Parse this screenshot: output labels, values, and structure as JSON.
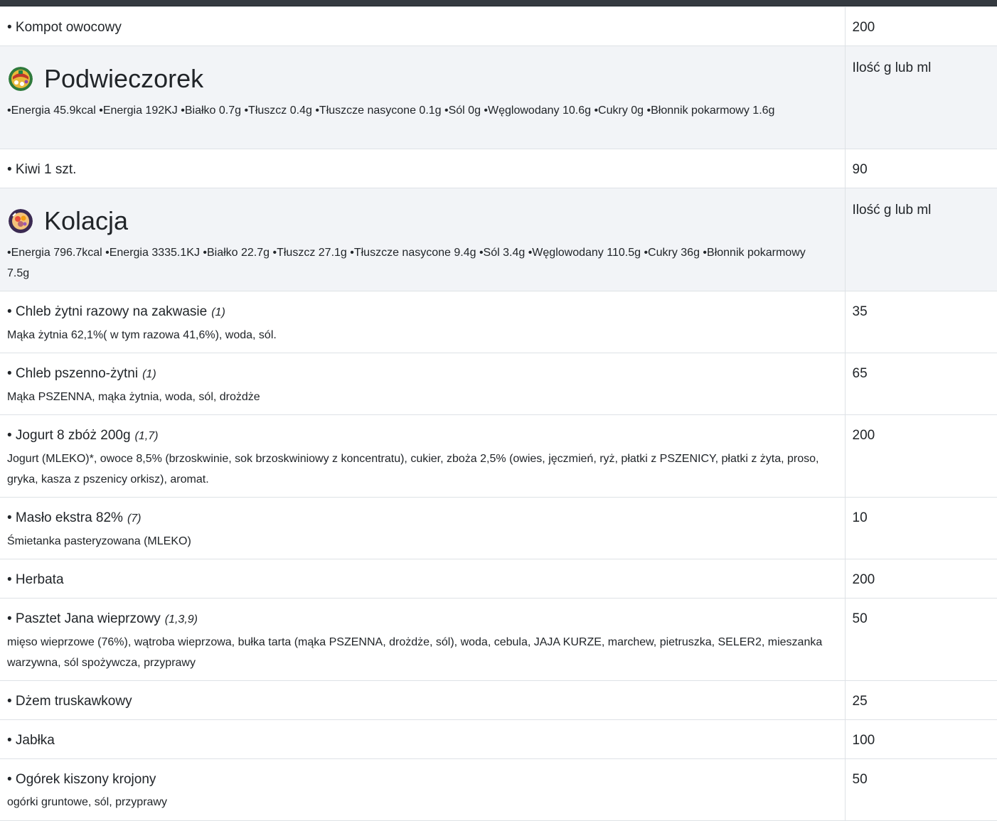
{
  "rows": [
    {
      "type": "item",
      "name": "• Kompot owocowy",
      "qty": "200"
    },
    {
      "type": "meal",
      "title": "Podwieczorek",
      "icon": "tea-time-icon",
      "qty_label": "Ilość g lub ml",
      "nutrition": "•Energia 45.9kcal •Energia 192KJ •Białko 0.7g •Tłuszcz 0.4g •Tłuszcze nasycone 0.1g •Sól 0g •Węglowodany 10.6g •Cukry 0g •Błonnik pokarmowy 1.6g"
    },
    {
      "type": "item",
      "name": "• Kiwi 1 szt.",
      "qty": "90"
    },
    {
      "type": "meal",
      "title": "Kolacja",
      "icon": "supper-icon",
      "qty_label": "Ilość g lub ml",
      "nutrition": "•Energia 796.7kcal •Energia 3335.1KJ •Białko 22.7g •Tłuszcz 27.1g •Tłuszcze nasycone 9.4g •Sól 3.4g •Węglowodany 110.5g •Cukry 36g •Błonnik pokarmowy 7.5g"
    },
    {
      "type": "item",
      "name": "• Chleb żytni razowy na zakwasie",
      "allergens": "(1)",
      "ingredients": "Mąka żytnia 62,1%( w tym razowa 41,6%), woda, sól.",
      "qty": "35"
    },
    {
      "type": "item",
      "name": "• Chleb pszenno-żytni",
      "allergens": "(1)",
      "ingredients": "Mąka PSZENNA, mąka żytnia, woda, sól, drożdże",
      "qty": "65"
    },
    {
      "type": "item",
      "name": "• Jogurt 8 zbóż 200g",
      "allergens": "(1,7)",
      "ingredients": "Jogurt (MLEKO)*, owoce 8,5% (brzoskwinie, sok brzoskwiniowy z koncentratu), cukier, zboża 2,5% (owies, jęczmień, ryż, płatki z PSZENICY, płatki z żyta, proso, gryka, kasza z pszenicy orkisz), aromat.",
      "qty": "200"
    },
    {
      "type": "item",
      "name": "• Masło ekstra 82%",
      "allergens": "(7)",
      "ingredients": "Śmietanka pasteryzowana (MLEKO)",
      "qty": "10"
    },
    {
      "type": "item",
      "name": "• Herbata",
      "qty": "200"
    },
    {
      "type": "item",
      "name": "• Pasztet Jana wieprzowy",
      "allergens": "(1,3,9)",
      "ingredients": "mięso wieprzowe (76%), wątroba wieprzowa, bułka tarta (mąka PSZENNA, drożdże, sól), woda, cebula, JAJA KURZE, marchew, pietruszka, SELER2, mieszanka warzywna, sól spożywcza, przyprawy",
      "qty": "50"
    },
    {
      "type": "item",
      "name": "• Dżem truskawkowy",
      "qty": "25"
    },
    {
      "type": "item",
      "name": "• Jabłka",
      "qty": "100"
    },
    {
      "type": "item",
      "name": "• Ogórek kiszony krojony",
      "ingredients": "ogórki gruntowe, sól, przyprawy",
      "qty": "50"
    }
  ],
  "colors": {
    "header_bar": "#343a40",
    "meal_row_bg": "#f2f4f7",
    "border": "#dee2e6",
    "text": "#212529"
  }
}
